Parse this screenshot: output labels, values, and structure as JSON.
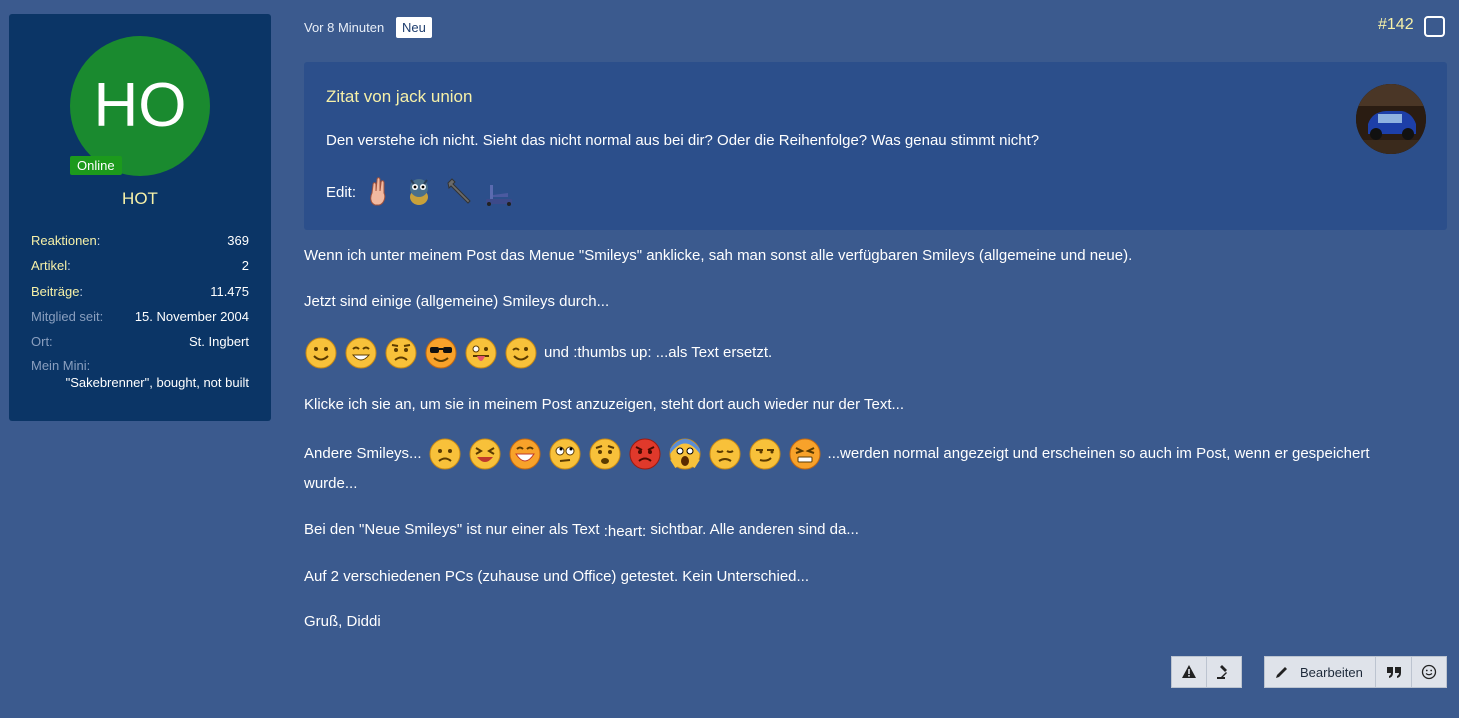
{
  "user": {
    "initials": "HO",
    "online_label": "Online",
    "name": "HOT",
    "stats": [
      {
        "label": "Reaktionen",
        "value": "369"
      },
      {
        "label": "Artikel",
        "value": "2"
      },
      {
        "label": "Beiträge",
        "value": "11.475"
      }
    ],
    "member_since_label": "Mitglied seit:",
    "member_since_value": "15. November 2004",
    "location_label": "Ort:",
    "location_value": "St. Ingbert",
    "mini_label": "Mein Mini:",
    "mini_value": "\"Sakebrenner\", bought, not built"
  },
  "post": {
    "time": "Vor 8 Minuten",
    "new_badge": "Neu",
    "number": "#142"
  },
  "quote": {
    "author": "Zitat von jack union",
    "text": "Den verstehe ich nicht. Sieht das nicht normal aus bei dir? Oder die Reihenfolge? Was genau stimmt nicht?",
    "edit_label": "Edit:"
  },
  "body": {
    "p1": "Wenn ich unter meinem Post das Menue \"Smileys\" anklicke, sah man sonst alle verfügbaren Smileys (allgemeine und neue).",
    "p2": "Jetzt sind einige (allgemeine) Smileys durch...",
    "p3_suffix": "und :thumbs up: ...als Text ersetzt.",
    "p4": "Klicke ich sie an, um sie in meinem Post anzuzeigen, steht dort auch wieder nur der Text...",
    "p5_prefix": "Andere Smileys...",
    "p5_suffix": "...werden normal angezeigt und erscheinen so auch im Post, wenn er gespeichert",
    "p5_cont": "wurde...",
    "p6_prefix": "Bei den \"Neue Smileys\" ist nur einer als Text",
    "p6_code": ":heart:",
    "p6_suffix": "sichtbar. Alle anderen sind da...",
    "p7": "Auf 2 verschiedenen PCs (zuhause und Office) getestet. Kein Unterschied...",
    "p8": "Gruß, Diddi"
  },
  "actions": {
    "edit_label": "Bearbeiten"
  },
  "colors": {
    "background": "#3b5a8e",
    "sidebar": "#0b3566",
    "quote_bg": "#2c4f8b",
    "accent_yellow": "#f7f1a8",
    "avatar_green": "#1a8a2f",
    "online_green": "#1c9a1c"
  }
}
